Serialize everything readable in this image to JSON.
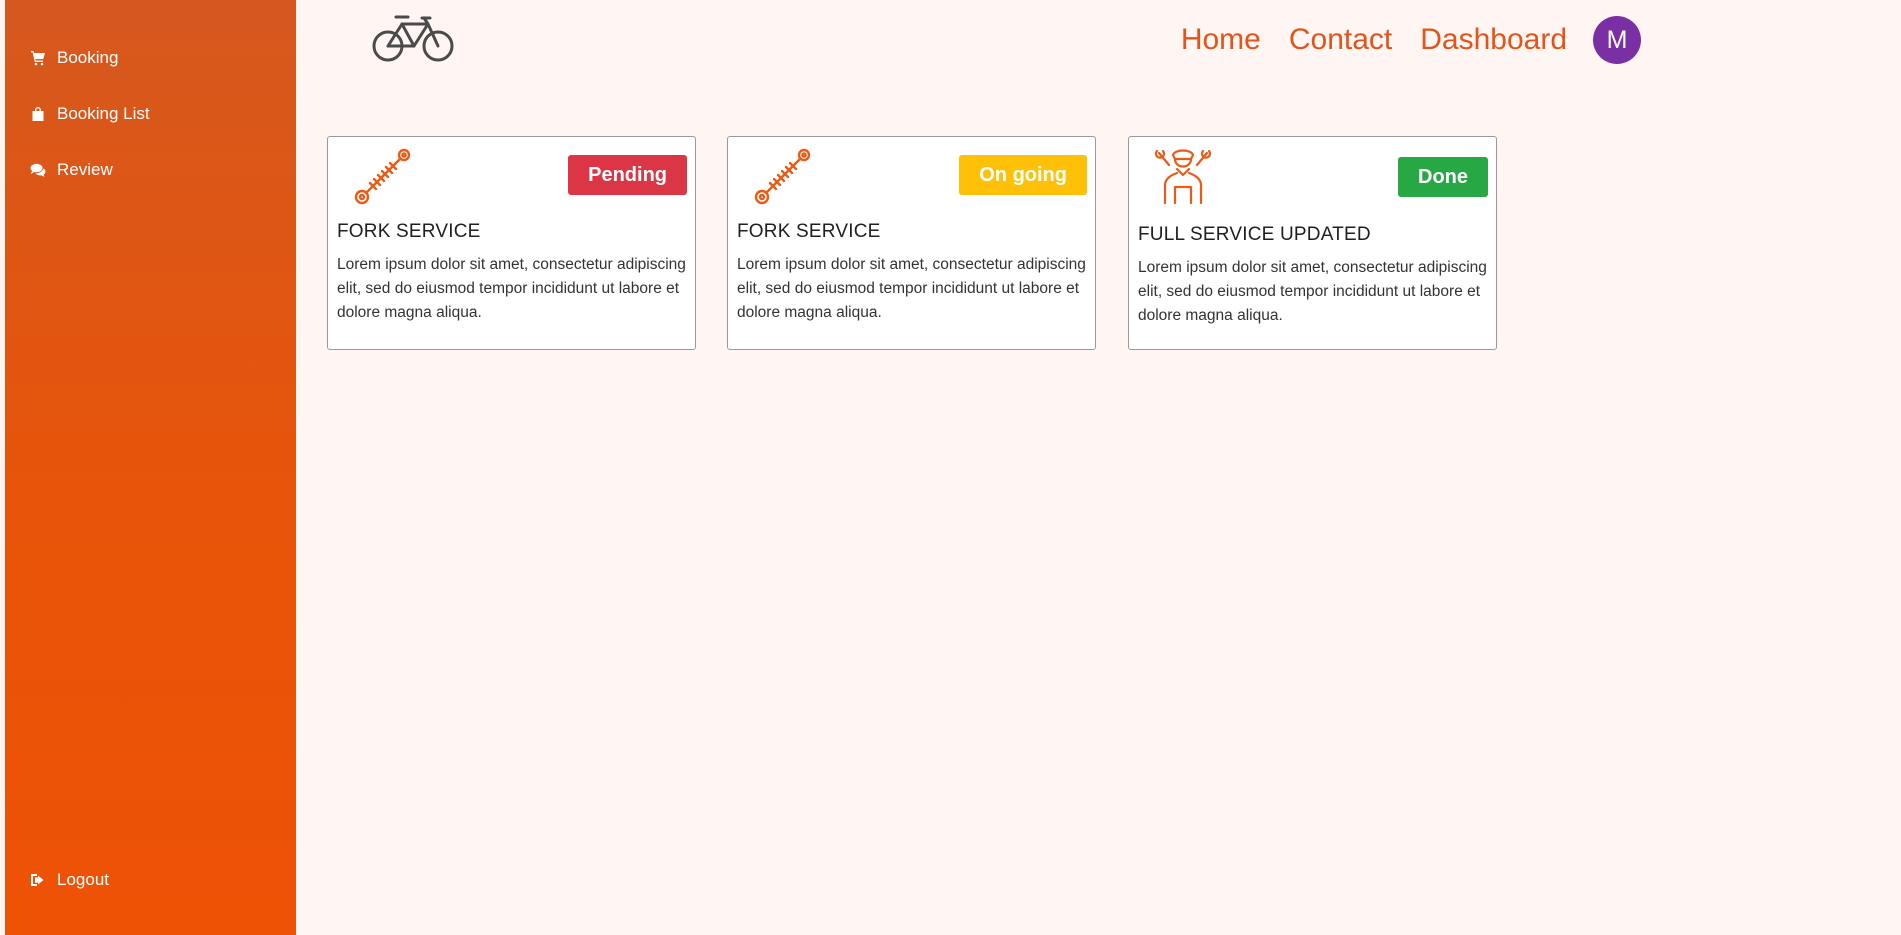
{
  "sidebar": {
    "items": [
      {
        "label": "Booking",
        "icon": "cart-icon"
      },
      {
        "label": "Booking List",
        "icon": "shopping-bag-icon"
      },
      {
        "label": "Review",
        "icon": "comments-icon"
      }
    ],
    "logout": {
      "label": "Logout",
      "icon": "sign-out-icon"
    }
  },
  "header": {
    "logo_icon": "bicycle-icon",
    "nav": [
      "Home",
      "Contact",
      "Dashboard"
    ],
    "avatar_initial": "M"
  },
  "colors": {
    "accent": "#e2541a",
    "sidebar": "#e85409",
    "pending": "#dc3545",
    "ongoing": "#ffc107",
    "done": "#28a745",
    "avatar": "#7b2fa5"
  },
  "cards": [
    {
      "icon": "shock-absorber-icon",
      "status": "Pending",
      "title": "FORK SERVICE",
      "description": "Lorem ipsum dolor sit amet, consectetur adipiscing elit, sed do eiusmod tempor incididunt ut labore et dolore magna aliqua."
    },
    {
      "icon": "shock-absorber-icon",
      "status": "On going",
      "title": "FORK SERVICE",
      "description": "Lorem ipsum dolor sit amet, consectetur adipiscing elit, sed do eiusmod tempor incididunt ut labore et dolore magna aliqua."
    },
    {
      "icon": "mechanic-icon",
      "status": "Done",
      "title": "FULL SERVICE UPDATED",
      "description": "Lorem ipsum dolor sit amet, consectetur adipiscing elit, sed do eiusmod tempor incididunt ut labore et dolore magna aliqua."
    }
  ]
}
